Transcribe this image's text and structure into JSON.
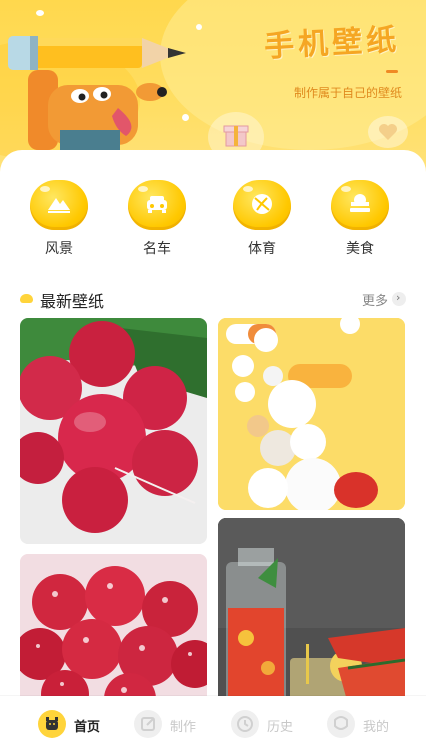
{
  "header": {
    "title": "手机壁纸",
    "subtitle": "制作属于自己的壁纸"
  },
  "categories": [
    {
      "label": "风景",
      "icon": "mountain-icon"
    },
    {
      "label": "名车",
      "icon": "car-icon"
    },
    {
      "label": "体育",
      "icon": "ball-icon"
    },
    {
      "label": "美食",
      "icon": "chef-hat-icon"
    }
  ],
  "section": {
    "title": "最新壁纸",
    "more": "更多",
    "more_arrow": "›"
  },
  "wallpapers": [
    {
      "subject": "radishes"
    },
    {
      "subject": "pills"
    },
    {
      "subject": "frosted-berry"
    },
    {
      "subject": "watermelon-drink"
    }
  ],
  "tabbar": {
    "items": [
      {
        "label": "首页",
        "icon": "home-icon",
        "active": true
      },
      {
        "label": "制作",
        "icon": "edit-icon",
        "active": false
      },
      {
        "label": "历史",
        "icon": "clock-icon",
        "active": false
      },
      {
        "label": "我的",
        "icon": "user-icon",
        "active": false
      }
    ]
  },
  "colors": {
    "accent": "#ffd43b",
    "title": "#f5a623"
  }
}
